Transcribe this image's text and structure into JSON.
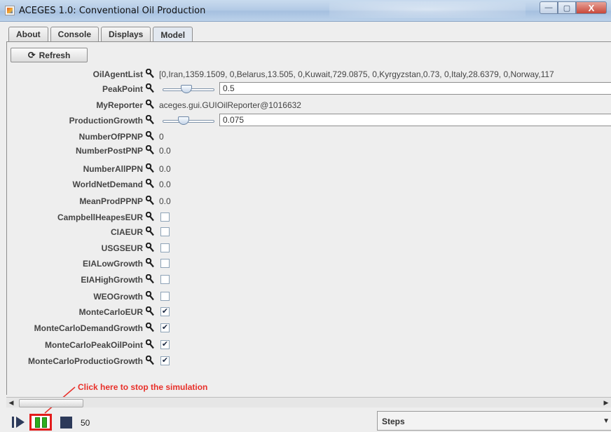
{
  "window": {
    "title": "ACEGES 1.0: Conventional Oil Production",
    "minimize_glyph": "—",
    "maximize_glyph": "▢",
    "close_glyph": "X"
  },
  "tabs": [
    {
      "label": "About",
      "active": false
    },
    {
      "label": "Console",
      "active": false
    },
    {
      "label": "Displays",
      "active": false
    },
    {
      "label": "Model",
      "active": true
    }
  ],
  "refresh_button": {
    "label": "Refresh",
    "icon": "refresh-icon"
  },
  "properties": [
    {
      "name": "OilAgentList",
      "type": "text",
      "value": "[0,Iran,1359.1509, 0,Belarus,13.505, 0,Kuwait,729.0875, 0,Kyrgyzstan,0.73, 0,Italy,28.6379, 0,Norway,117"
    },
    {
      "name": "PeakPoint",
      "type": "slider",
      "value": "0.5",
      "slider_level": 0.45
    },
    {
      "name": "MyReporter",
      "type": "text",
      "value": "aceges.gui.GUIOilReporter@1016632"
    },
    {
      "name": "ProductionGrowth",
      "type": "slider",
      "value": "0.075",
      "slider_level": 0.38
    },
    {
      "name": "NumberOfPPNP",
      "type": "text",
      "value": "0"
    },
    {
      "name": "NumberPostPNP",
      "type": "text",
      "value": "0.0"
    },
    {
      "name": "NumberAllPPN",
      "type": "text",
      "value": "0.0"
    },
    {
      "name": "WorldNetDemand",
      "type": "text",
      "value": "0.0"
    },
    {
      "name": "MeanProdPPNP",
      "type": "text",
      "value": "0.0"
    },
    {
      "name": "CampbellHeapesEUR",
      "type": "checkbox",
      "checked": false
    },
    {
      "name": "CIAEUR",
      "type": "checkbox",
      "checked": false
    },
    {
      "name": "USGSEUR",
      "type": "checkbox",
      "checked": false
    },
    {
      "name": "EIALowGrowth",
      "type": "checkbox",
      "checked": false
    },
    {
      "name": "EIAHighGrowth",
      "type": "checkbox",
      "checked": false
    },
    {
      "name": "WEOGrowth",
      "type": "checkbox",
      "checked": false
    },
    {
      "name": "MonteCarloEUR",
      "type": "checkbox",
      "checked": true
    },
    {
      "name": "MonteCarloDemandGrowth",
      "type": "checkbox",
      "checked": true
    },
    {
      "name": "MonteCarloPeakOilPoint",
      "type": "checkbox",
      "checked": true
    },
    {
      "name": "MonteCarloProductioGrowth",
      "type": "checkbox",
      "checked": true
    }
  ],
  "annotation": {
    "text": "Click here to stop the simulation",
    "color": "#e8302a"
  },
  "controls": {
    "step_count": "50",
    "step_mode": "Steps",
    "pause_color": "#2fae1f",
    "highlight_color": "#e31b1b"
  },
  "icons": {
    "property": "wrench-icon",
    "play": "step-play-icon",
    "pause": "pause-icon",
    "stop": "stop-icon"
  }
}
